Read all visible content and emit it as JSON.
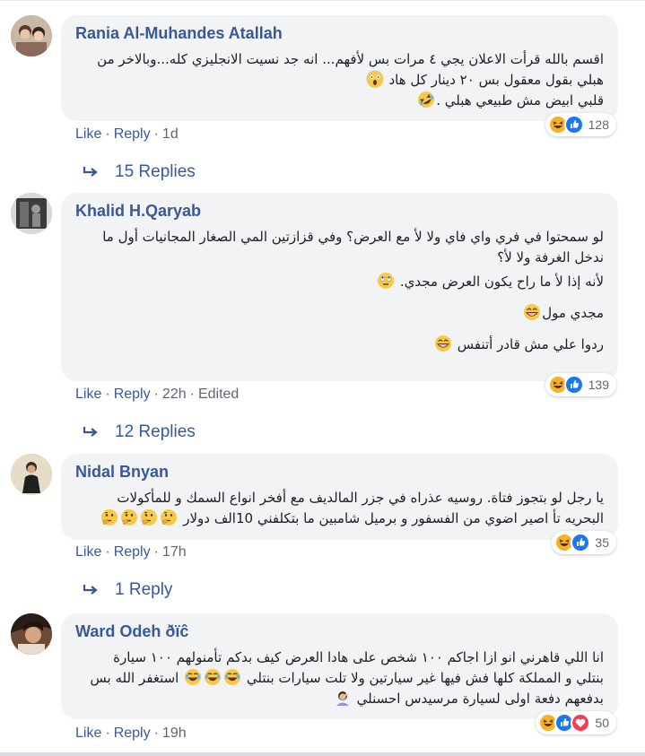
{
  "actions": {
    "like": "Like",
    "reply": "Reply",
    "separator": "·"
  },
  "colors": {
    "link": "#385898",
    "bubble": "#f2f3f5",
    "meta": "#606770",
    "haha_yellow": "#f7b125",
    "like_blue": "#1877f2",
    "love_red": "#f33e58"
  },
  "comments": [
    {
      "author": "Rania Al-Muhandes Atallah",
      "lines": [
        "اقسم بالله قرأت الاعلان يجي ٤ مرات بس لأفهم... انه جد نسيت الانجليزي كله...وبالاخر من",
        "هبلي بقول معقول بس ٢٠ دينار كل هاد",
        "قلبي ابيض مش طبيعي هبلي ."
      ],
      "line_emojis": [
        "",
        "scream-emoji",
        "rofl-emoji"
      ],
      "reactions": [
        "haha-icon",
        "like-icon"
      ],
      "reaction_count": "128",
      "age": "1d",
      "edited": "",
      "replies_label": "15 Replies"
    },
    {
      "author": "Khalid H.Qaryab",
      "lines": [
        "لو سمحتوا في فري واي فاي ولا لأ مع العرض؟ وفي قزازتين المي الصغار المجانيات أول ما",
        "ندخل الغرفة ولا لأ؟",
        "لأنه إذا لأ ما راح يكون العرض مجدي.",
        "مجدي مول",
        "ردوا علي مش قادر أتنفس"
      ],
      "line_emojis": [
        "",
        "",
        "rolling-eyes-emoji",
        "grin-emoji",
        "grin-emoji"
      ],
      "reactions": [
        "haha-icon",
        "like-icon"
      ],
      "reaction_count": "139",
      "age": "22h",
      "edited": "Edited",
      "replies_label": "12 Replies"
    },
    {
      "author": "Nidal Bnyan",
      "lines": [
        "يا رجل لو بتجوز فتاة. روسيه عذراه في جزر المالديف مع أفخر انواع السمك و للمأكولات",
        "البحريه تأ اصير اضوي من الفسفور و برميل شامبين ما بتكلفني 10الف دولار"
      ],
      "line_emojis": [
        "",
        "thinking-emoji-x4"
      ],
      "reactions": [
        "haha-icon",
        "like-icon"
      ],
      "reaction_count": "35",
      "age": "17h",
      "edited": "",
      "replies_label": "1 Reply"
    },
    {
      "author": "Ward Odeh",
      "author_suffix": "ðïĉ",
      "lines": [
        "انا اللي قاهرني انو ازا اجاكم ١٠٠ شخص على هادا العرض كيف بدكم تأمنولهم ١٠٠ سيارة",
        "بنتلي و المملكة كلها فش فيها غير سيارتين ولا تلت سيارات بنتلي",
        "استغفر الله بس",
        "بدفعهم دفعة اولى لسيارة مرسيدس احسنلي"
      ],
      "line_emojis": [
        "",
        "",
        "joy-emoji-x3",
        "facepalm-emoji"
      ],
      "reactions": [
        "haha-icon",
        "like-icon",
        "love-icon"
      ],
      "reaction_count": "50",
      "age": "19h",
      "edited": "",
      "replies_label": ""
    }
  ]
}
